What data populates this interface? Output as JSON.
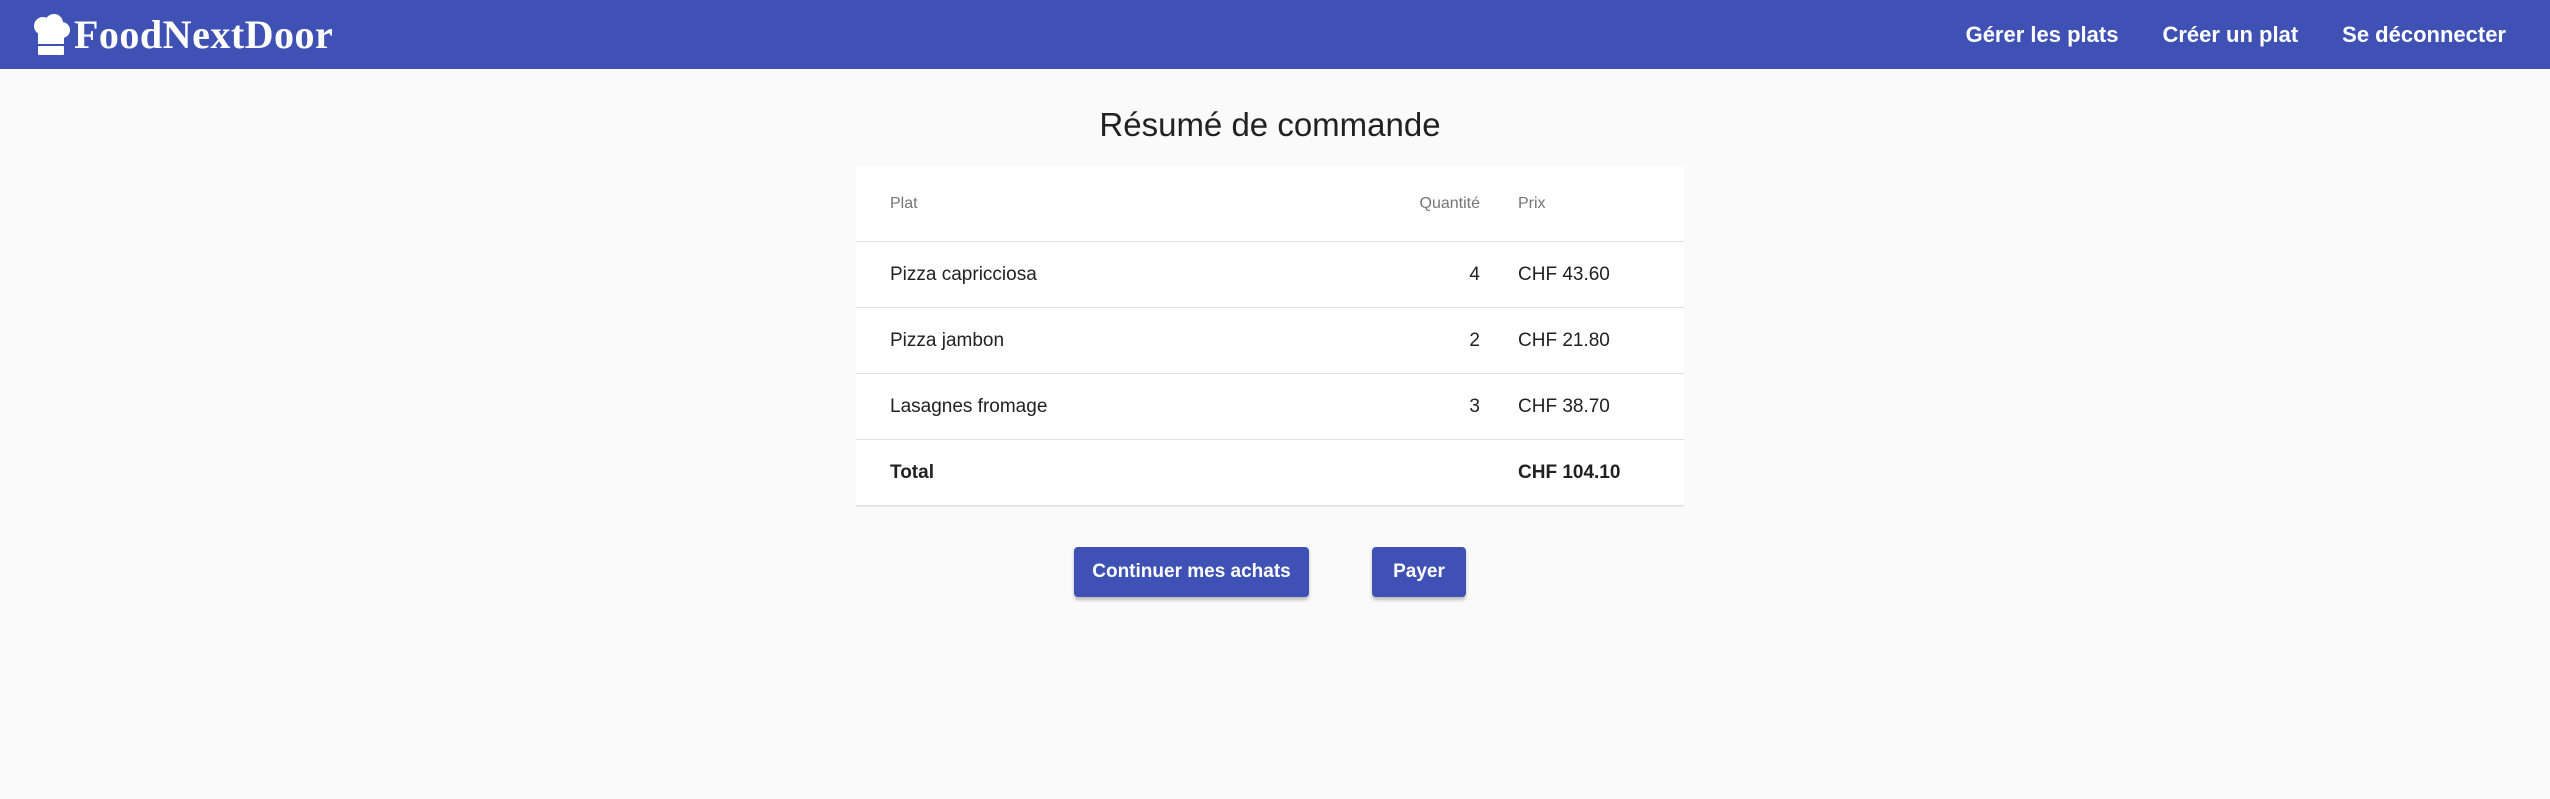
{
  "header": {
    "brand": "FoodNextDoor",
    "brand_icon": "chef-hat-icon",
    "nav": [
      {
        "label": "Gérer les plats"
      },
      {
        "label": "Créer un plat"
      },
      {
        "label": "Se déconnecter"
      }
    ]
  },
  "page": {
    "title": "Résumé de commande"
  },
  "table": {
    "columns": [
      "Plat",
      "Quantité",
      "Prix"
    ],
    "rows": [
      {
        "plat": "Pizza capricciosa",
        "quantite": "4",
        "prix": "CHF 43.60"
      },
      {
        "plat": "Pizza jambon",
        "quantite": "2",
        "prix": "CHF 21.80"
      },
      {
        "plat": "Lasagnes fromage",
        "quantite": "3",
        "prix": "CHF 38.70"
      }
    ],
    "total": {
      "label": "Total",
      "value": "CHF 104.10"
    }
  },
  "actions": {
    "continue_label": "Continuer mes achats",
    "pay_label": "Payer"
  },
  "colors": {
    "primary": "#3f51b5",
    "background": "#fafafa"
  }
}
